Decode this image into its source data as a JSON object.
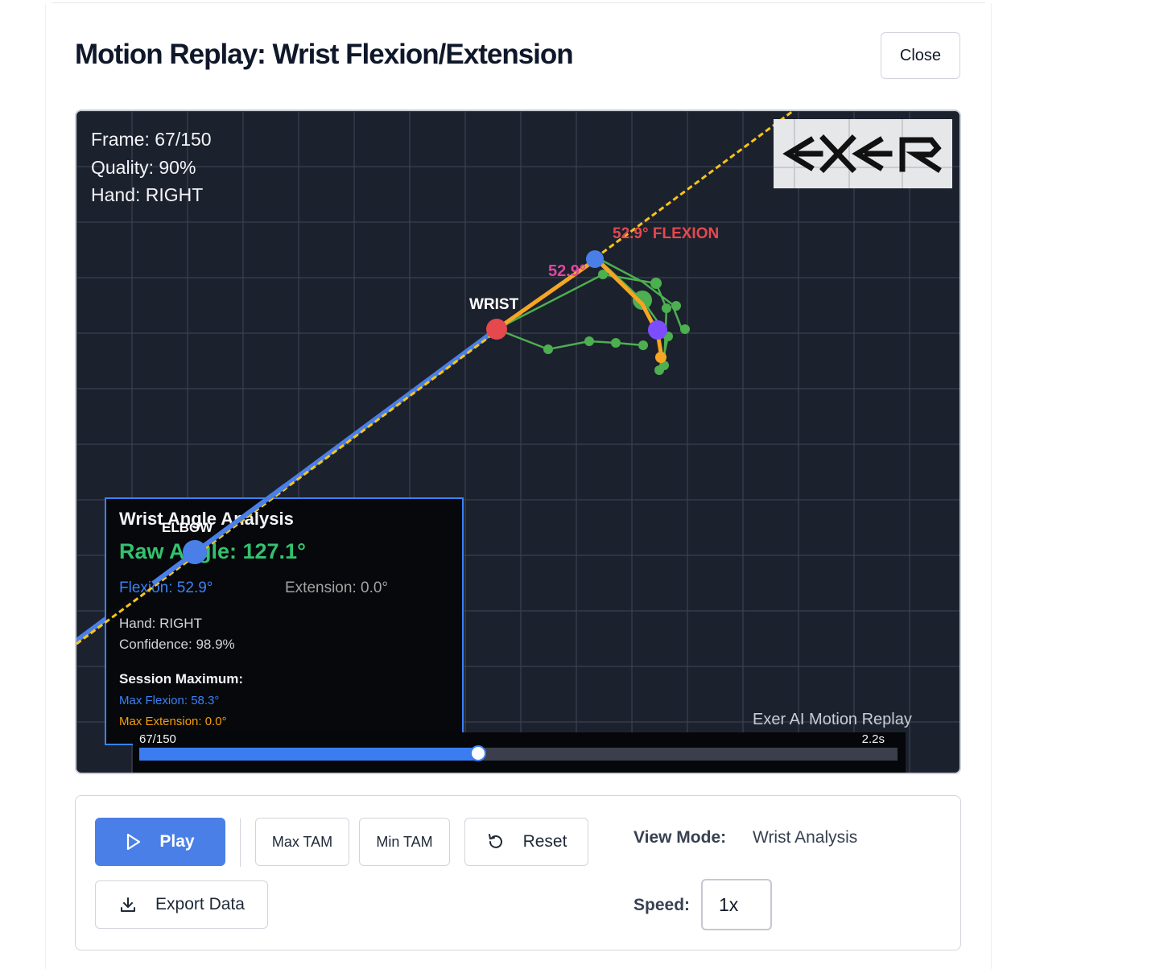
{
  "modal": {
    "title": "Motion Replay: Wrist Flexion/Extension",
    "close_label": "Close"
  },
  "viewer": {
    "hud": {
      "frame": "Frame: 67/150",
      "quality": "Quality: 90%",
      "hand": "Hand: RIGHT"
    },
    "logo_text": "EXER",
    "labels": {
      "wrist": "WRIST",
      "elbow": "ELBOW",
      "flexion_tag": "52.9° FLEXION",
      "angle_tag": "52.9°"
    },
    "analysis": {
      "title": "Wrist Angle Analysis",
      "raw_angle": "Raw Angle: 127.1°",
      "flexion": "Flexion: 52.9°",
      "extension": "Extension: 0.0°",
      "hand": "Hand: RIGHT",
      "confidence": "Confidence: 98.9%",
      "session_heading": "Session Maximum:",
      "max_flexion": "Max Flexion: 58.3°",
      "max_extension": "Max Extension: 0.0°"
    },
    "watermark": "Exer AI Motion Replay",
    "timeline": {
      "frame_label": "67/150",
      "time_label": "2.2s",
      "current_frame": 67,
      "total_frames": 150
    },
    "colors": {
      "background": "#1c212e",
      "wrist": "#e5484d",
      "elbow": "#4a7fe8",
      "hand_skeleton": "#4caf50",
      "highlight": "#f5a623",
      "flexion_text": "#e5484d",
      "angle_text": "#e0479e"
    }
  },
  "controls": {
    "play_label": "Play",
    "max_tam_label": "Max TAM",
    "min_tam_label": "Min TAM",
    "reset_label": "Reset",
    "export_label": "Export Data",
    "view_mode_label": "View Mode:",
    "view_mode_value": "Wrist Analysis",
    "speed_label": "Speed:",
    "speed_value": "1x"
  }
}
